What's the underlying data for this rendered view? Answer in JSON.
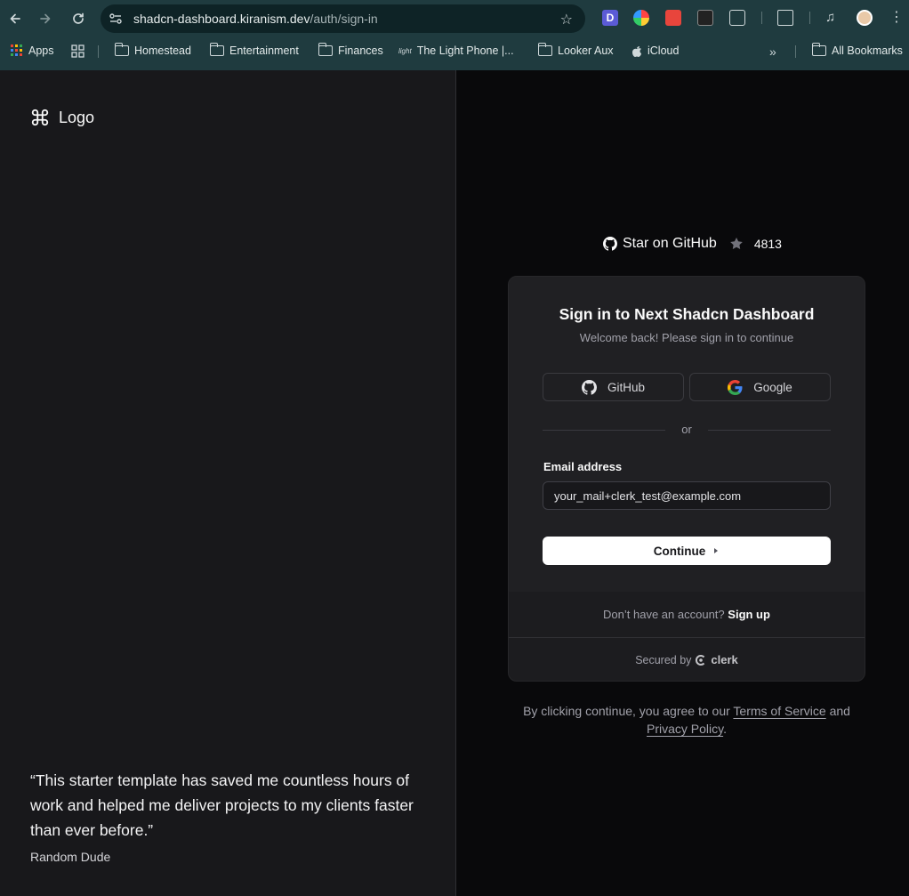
{
  "browser": {
    "url_host": "shadcn-dashboard.kiranism.dev",
    "url_path": "/auth/sign-in",
    "bookmarks": [
      "Apps",
      "Homestead",
      "Entertainment",
      "Finances",
      "The Light Phone |...",
      "Looker Aux",
      "iCloud",
      "All Bookmarks"
    ],
    "light_phone_prefix": "light"
  },
  "left": {
    "logo_text": "Logo",
    "quote": "“This starter template has saved me countless hours of work and helped me deliver projects to my clients faster than ever before.”",
    "author": "Random Dude"
  },
  "right": {
    "github_star_label": "Star on GitHub",
    "github_star_count": "4813",
    "card": {
      "title": "Sign in to Next Shadcn Dashboard",
      "subtitle": "Welcome back! Please sign in to continue",
      "github_button": "GitHub",
      "google_button": "Google",
      "divider": "or",
      "email_label": "Email address",
      "email_value": "your_mail+clerk_test@example.com",
      "continue_label": "Continue",
      "no_account": "Don’t have an account?",
      "sign_up": "Sign up",
      "secured_by": "Secured by",
      "clerk": "clerk"
    },
    "terms": {
      "prefix": "By clicking continue, you agree to our",
      "tos": "Terms of Service",
      "and": "and",
      "privacy": "Privacy Policy",
      "period": "."
    }
  },
  "colors": {
    "chrome": "#1f3b3f",
    "left_bg": "#18181b",
    "right_bg": "#09090b",
    "card_bg": "#202023"
  }
}
